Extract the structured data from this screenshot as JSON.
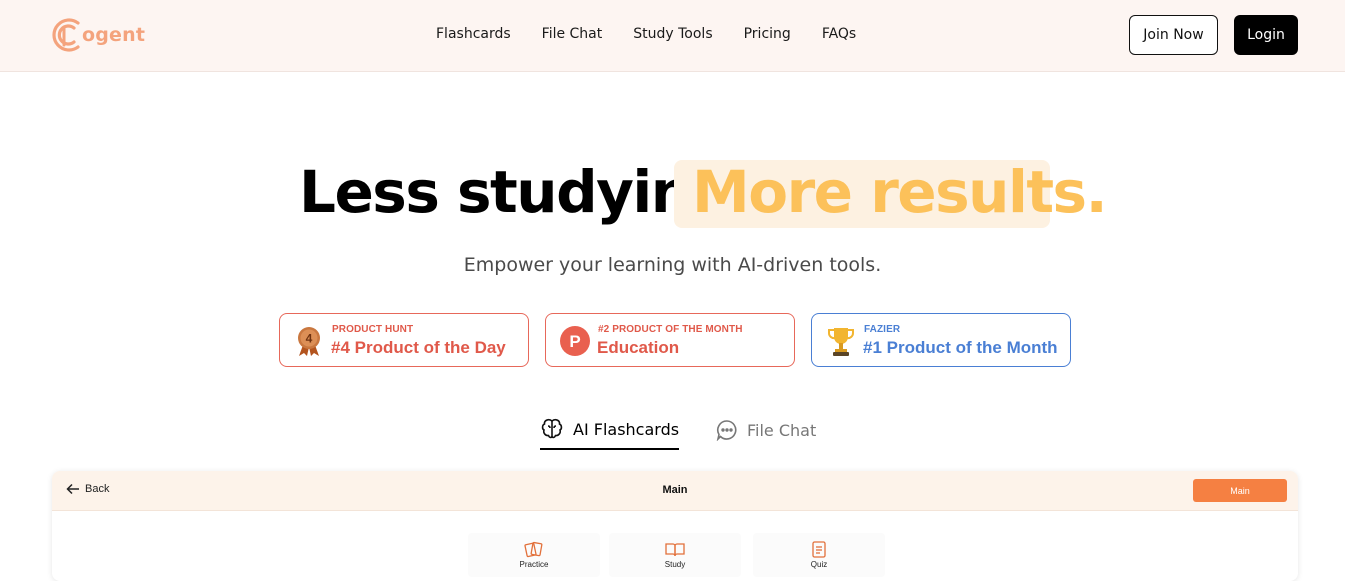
{
  "brand": {
    "logo_text": "ogent",
    "logo_color": "#f4a37d"
  },
  "nav": {
    "links": [
      "Flashcards",
      "File Chat",
      "Study Tools",
      "Pricing",
      "FAQs"
    ],
    "join_label": "Join Now",
    "login_label": "Login"
  },
  "hero": {
    "title_part1": "Less studying.",
    "title_part2": "More results.",
    "accent_color": "#fcc15a",
    "subtitle": "Empower your learning with AI-driven tools."
  },
  "badges": [
    {
      "small": "PRODUCT HUNT",
      "big": "#4 Product of the Day",
      "icon": "medal-icon",
      "medal_number": "4"
    },
    {
      "small": "#2 PRODUCT OF THE MONTH",
      "big": "Education",
      "icon": "producthunt-icon",
      "icon_letter": "P"
    },
    {
      "small": "FAZIER",
      "big": "#1 Product of the Month",
      "icon": "trophy-icon"
    }
  ],
  "tabs": [
    {
      "label": "AI Flashcards",
      "icon": "brain-icon",
      "active": true
    },
    {
      "label": "File Chat",
      "icon": "chat-bubble-icon",
      "active": false
    }
  ],
  "preview": {
    "back_label": "Back",
    "title": "Main",
    "button_label": "Main",
    "button_color": "#f58042",
    "modes": [
      {
        "label": "Practice",
        "icon": "cards-icon"
      },
      {
        "label": "Study",
        "icon": "book-icon"
      },
      {
        "label": "Quiz",
        "icon": "quiz-icon"
      }
    ]
  }
}
